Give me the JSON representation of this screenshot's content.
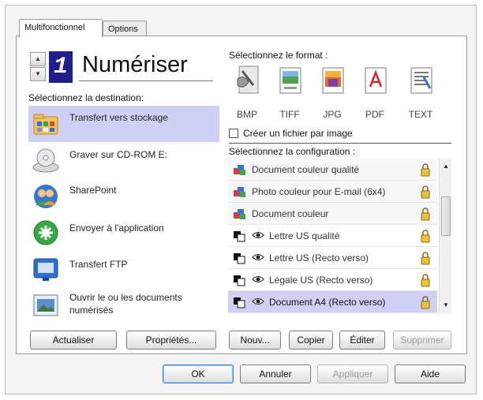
{
  "tabs": [
    {
      "label": "Multifonctionnel",
      "active": true
    },
    {
      "label": "Options",
      "active": false
    }
  ],
  "spinner": {
    "up": "▲",
    "down": "▼",
    "value": "1"
  },
  "scan_title": "Numériser",
  "destination": {
    "heading": "Sélectionnez la destination:",
    "items": [
      {
        "label": "Transfert vers stockage",
        "icon": "storage-folder-icon",
        "selected": true
      },
      {
        "label": "Graver sur CD-ROM  E:",
        "icon": "cd-burn-icon",
        "selected": false
      },
      {
        "label": "SharePoint",
        "icon": "sharepoint-icon",
        "selected": false
      },
      {
        "label": "Envoyer à l'application",
        "icon": "send-to-app-icon",
        "selected": false
      },
      {
        "label": "Transfert FTP",
        "icon": "ftp-icon",
        "selected": false
      },
      {
        "label": "Ouvrir le ou les documents",
        "label2": "numérisés",
        "icon": "open-document-icon",
        "selected": false
      }
    ]
  },
  "format": {
    "heading": "Sélectionnez le format :",
    "items": [
      {
        "label": "BMP"
      },
      {
        "label": "TIFF"
      },
      {
        "label": "JPG"
      },
      {
        "label": "PDF"
      },
      {
        "label": "TEXT"
      }
    ],
    "checkbox_label": "Créer un fichier par image"
  },
  "configuration": {
    "heading": "Sélectionnez la configuration :",
    "items": [
      {
        "label": "Document couleur qualité",
        "icon": "color-doc-icon",
        "selected": false
      },
      {
        "label": "Photo couleur pour E-mail (6x4)",
        "icon": "color-photo-icon",
        "selected": false
      },
      {
        "label": "Document couleur",
        "icon": "color-doc-icon",
        "selected": false
      },
      {
        "label": "Lettre US qualité",
        "icon": "bw-doc-icon",
        "selected": false
      },
      {
        "label": "Lettre US (Recto verso)",
        "icon": "bw-doc-icon",
        "selected": false
      },
      {
        "label": "Légale US (Recto verso)",
        "icon": "bw-doc-icon",
        "selected": false
      },
      {
        "label": "Document A4 (Recto verso)",
        "icon": "bw-doc-icon",
        "selected": true
      }
    ]
  },
  "panel_buttons": {
    "refresh": "Actualiser",
    "properties": "Propriétés...",
    "new": "Nouv...",
    "copy": "Copier",
    "edit": "Éditer",
    "delete": "Supprimer"
  },
  "dialog_buttons": {
    "ok": "OK",
    "cancel": "Annuler",
    "apply": "Appliquer",
    "help": "Aide"
  },
  "colors": {
    "selection": "#cfd0f4",
    "counter_bg": "#1f1e8a",
    "default_border": "#3b7dd8"
  }
}
